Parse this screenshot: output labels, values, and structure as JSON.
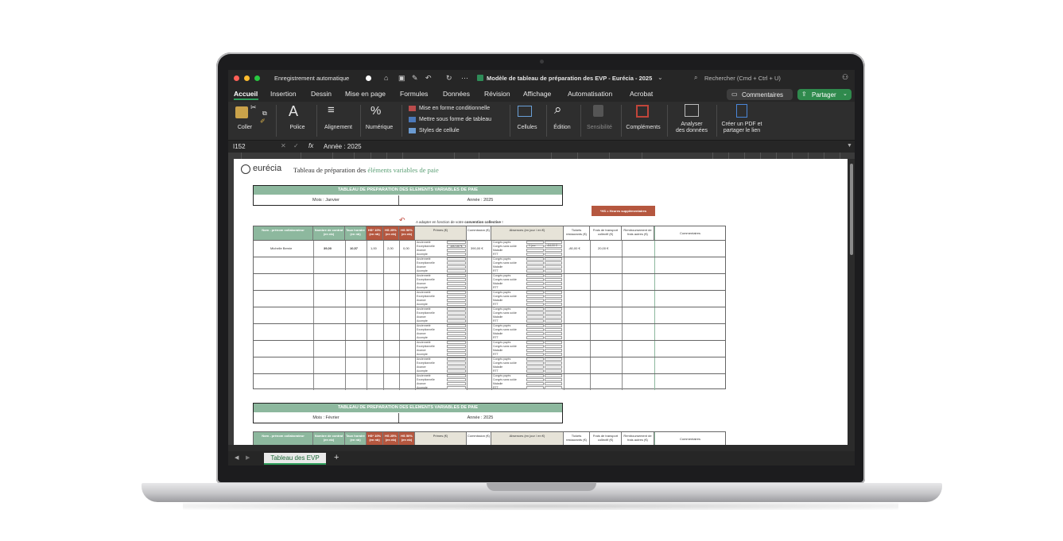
{
  "window": {
    "autosave_label": "Enregistrement automatique",
    "doc_title": "Modèle de tableau de préparation des EVP - Eurécia - 2025",
    "search_placeholder": "Rechercher (Cmd + Ctrl + U)"
  },
  "tabs": [
    "Accueil",
    "Insertion",
    "Dessin",
    "Mise en page",
    "Formules",
    "Données",
    "Révision",
    "Affichage",
    "Automatisation",
    "Acrobat"
  ],
  "actions": {
    "comments_label": "Commentaires",
    "share_label": "Partager"
  },
  "ribbon": {
    "paste": "Coller",
    "font": "Police",
    "alignment": "Alignement",
    "number": "Numérique",
    "conditional": "Mise en forme conditionnelle",
    "format_table": "Mettre sous forme de tableau",
    "cell_styles": "Styles de cellule",
    "cells": "Cellules",
    "editing": "Édition",
    "sensitivity": "Sensibilité",
    "addins": "Compléments",
    "analyze_1": "Analyser",
    "analyze_2": "des données",
    "pdf_1": "Créer un PDF et",
    "pdf_2": "partager le lien"
  },
  "formula_bar": {
    "name_box": "I152",
    "fx": "fx",
    "content": "Année : 2025"
  },
  "sheet": {
    "logo": "eurécia",
    "title_plain": "Tableau de préparation des ",
    "title_highlight": "éléments variables de paie",
    "block1": {
      "band": "TABLEAU DE PREPARATION DES ELEMENTS VARIABLES DE PAIE",
      "month": "Mois : Janvier",
      "year": "Année : 2025"
    },
    "block2": {
      "band": "TABLEAU DE PREPARATION DES ELEMENTS VARIABLES DE PAIE",
      "month": "Mois : Février",
      "year": "Année : 2025"
    },
    "note_prefix": "A adapter en fonction de votre ",
    "note_bold": "convention collective",
    "note_suffix": " !",
    "hs_note": "*HS = Heures supplémentaires",
    "headers": {
      "name": "Nom - prénom collaborateur",
      "hours": "Nombre de contrat (en nb)",
      "rate": "Taux horaire (en nb)",
      "hs10": "HS* 10% (en nb)",
      "hs25": "HS 25% (en nb)",
      "hs50": "HS 50% (en nb)",
      "primes": "Primes (€)",
      "commission": "Commission (€)",
      "absences": "Absences (en jour / en €)",
      "tickets": "Tickets restaurants (€)",
      "transport": "Frais de transport collectif (€)",
      "remb": "Remboursement de frais autres (€)",
      "comments": "Commentaires"
    },
    "prime_types": [
      "Ancienneté",
      "Exceptionnelle",
      "Avance",
      "Acompte"
    ],
    "absence_types": [
      "Congés payés",
      "Congés sans solde",
      "Maladie",
      "RTT"
    ],
    "first_row": {
      "name": "Michelle Bernie",
      "hours": "39,00",
      "rate": "10,57",
      "hs10": "1,00",
      "hs25": "2,00",
      "hs50": "0,00",
      "prime_exc": "150,00 €",
      "commission": "390,00 €",
      "abs_value": "1 jour",
      "abs_amount": "-84,00 €",
      "tickets": "-80,00 €",
      "transport": "20,00 €"
    },
    "sheet_tab": "Tableau des EVP"
  }
}
